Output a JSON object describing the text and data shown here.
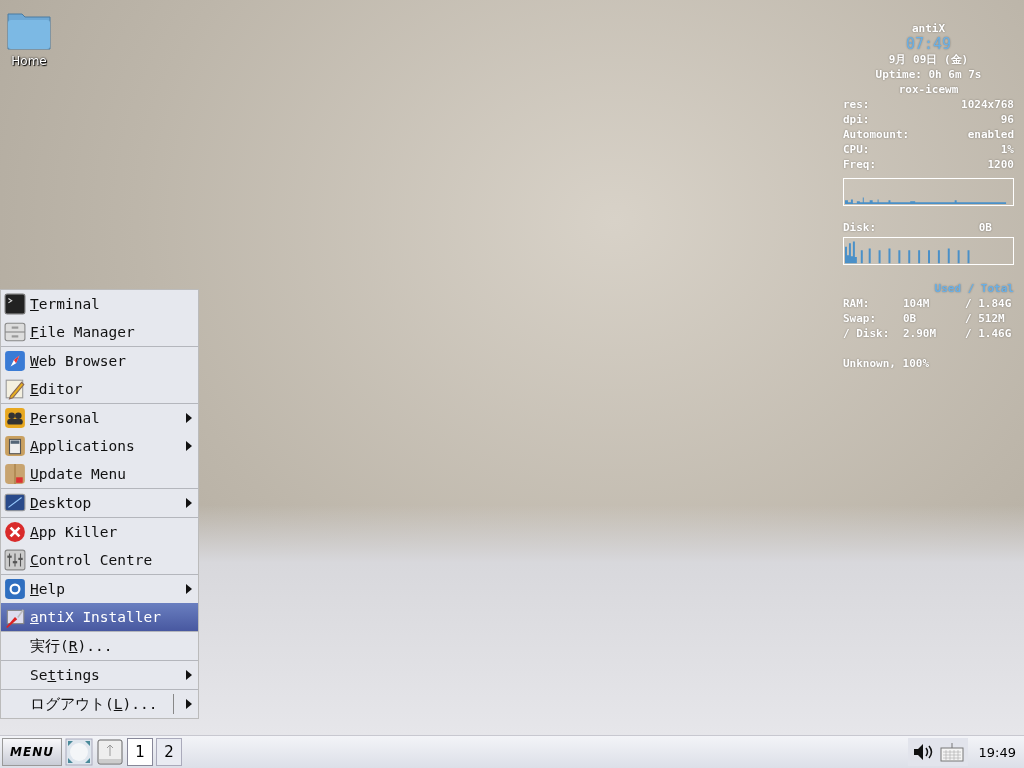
{
  "desktop_icons": [
    {
      "label": "Home"
    }
  ],
  "conky": {
    "header": [
      {
        "kind": "host",
        "text": "antiX"
      },
      {
        "kind": "clock",
        "text": "07:49"
      },
      {
        "kind": "line",
        "text": "9月 09日 (金)"
      },
      {
        "kind": "line",
        "text": "Uptime: 0h 6m 7s"
      },
      {
        "kind": "line",
        "text": "rox-icewm"
      }
    ],
    "stats": [
      {
        "key": "res:",
        "value": "1024x768"
      },
      {
        "key": "dpi:",
        "value": "96"
      },
      {
        "key": "Automount:",
        "value": "enabled"
      },
      {
        "key": "CPU:",
        "value": "1%"
      },
      {
        "key": "Freq:",
        "value": "1200"
      }
    ],
    "disk": {
      "key": "Disk:",
      "value": "0B"
    },
    "memory_header": "Used / Total",
    "memory": [
      {
        "key": "RAM:",
        "used": "104M",
        "total": "/ 1.84G"
      },
      {
        "key": "Swap:",
        "used": "0B",
        "total": "/ 512M"
      },
      {
        "key": "/ Disk:",
        "used": "2.90M",
        "total": "/ 1.46G"
      }
    ],
    "battery": "Unknown, 100%"
  },
  "menu": {
    "groups": [
      [
        {
          "label": [
            {
              "text": "T",
              "underline": true
            },
            {
              "text": "erminal",
              "underline": false
            }
          ],
          "submenu": false,
          "split": false,
          "selected": false
        },
        {
          "label": [
            {
              "text": "F",
              "underline": true
            },
            {
              "text": "ile Manager",
              "underline": false
            }
          ],
          "submenu": false,
          "split": false,
          "selected": false
        }
      ],
      [
        {
          "label": [
            {
              "text": "W",
              "underline": true
            },
            {
              "text": "eb Browser",
              "underline": false
            }
          ],
          "submenu": false,
          "split": false,
          "selected": false
        },
        {
          "label": [
            {
              "text": "E",
              "underline": true
            },
            {
              "text": "ditor",
              "underline": false
            }
          ],
          "submenu": false,
          "split": false,
          "selected": false
        }
      ],
      [
        {
          "label": [
            {
              "text": "P",
              "underline": true
            },
            {
              "text": "ersonal",
              "underline": false
            }
          ],
          "submenu": true,
          "split": false,
          "selected": false
        },
        {
          "label": [
            {
              "text": "A",
              "underline": true
            },
            {
              "text": "pplications",
              "underline": false
            }
          ],
          "submenu": true,
          "split": false,
          "selected": false
        },
        {
          "label": [
            {
              "text": "U",
              "underline": true
            },
            {
              "text": "pdate Menu",
              "underline": false
            }
          ],
          "submenu": false,
          "split": false,
          "selected": false
        }
      ],
      [
        {
          "label": [
            {
              "text": "D",
              "underline": true
            },
            {
              "text": "esktop",
              "underline": false
            }
          ],
          "submenu": true,
          "split": false,
          "selected": false
        }
      ],
      [
        {
          "label": [
            {
              "text": "A",
              "underline": true
            },
            {
              "text": "pp Killer",
              "underline": false
            }
          ],
          "submenu": false,
          "split": false,
          "selected": false
        },
        {
          "label": [
            {
              "text": "C",
              "underline": true
            },
            {
              "text": "ontrol Centre",
              "underline": false
            }
          ],
          "submenu": false,
          "split": false,
          "selected": false
        }
      ],
      [
        {
          "label": [
            {
              "text": "H",
              "underline": true
            },
            {
              "text": "elp",
              "underline": false
            }
          ],
          "submenu": true,
          "split": false,
          "selected": false
        },
        {
          "label": [
            {
              "text": "a",
              "underline": true
            },
            {
              "text": "ntiX Installer",
              "underline": false
            }
          ],
          "submenu": false,
          "split": false,
          "selected": true
        }
      ],
      [
        {
          "label": [
            {
              "text": "実行(",
              "underline": false
            },
            {
              "text": "R",
              "underline": true
            },
            {
              "text": ")...",
              "underline": false
            }
          ],
          "submenu": false,
          "split": false,
          "selected": false
        }
      ],
      [
        {
          "label": [
            {
              "text": "Se",
              "underline": false
            },
            {
              "text": "t",
              "underline": true
            },
            {
              "text": "tings",
              "underline": false
            }
          ],
          "submenu": true,
          "split": false,
          "selected": false
        }
      ],
      [
        {
          "label": [
            {
              "text": "ログアウト(",
              "underline": false
            },
            {
              "text": "L",
              "underline": true
            },
            {
              "text": ")...",
              "underline": false
            }
          ],
          "submenu": true,
          "split": true,
          "selected": false
        }
      ]
    ]
  },
  "taskbar": {
    "menu_button": "MENU",
    "workspaces": [
      {
        "label": "1",
        "selected": true
      },
      {
        "label": "2",
        "selected": false
      }
    ],
    "clock": "19:49"
  }
}
